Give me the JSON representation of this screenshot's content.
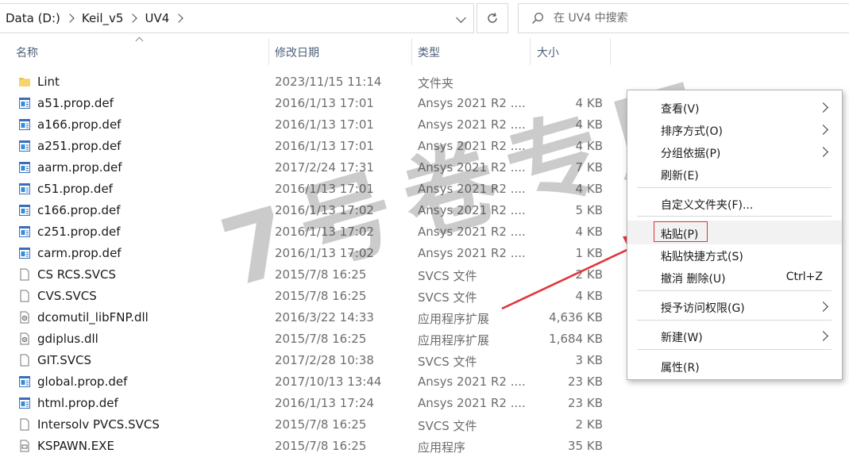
{
  "address_bar": {
    "crumbs": [
      "Data (D:)",
      "Keil_v5",
      "UV4"
    ]
  },
  "search": {
    "placeholder": "在 UV4 中搜索"
  },
  "columns": {
    "name": "名称",
    "date": "修改日期",
    "type": "类型",
    "size": "大小"
  },
  "files": [
    {
      "name": "Lint",
      "date": "2023/11/15 11:14",
      "type": "文件夹",
      "size": "",
      "icon": "folder-icon"
    },
    {
      "name": "a51.prop.def",
      "date": "2016/1/13 17:01",
      "type": "Ansys 2021 R2 ....",
      "size": "4 KB",
      "icon": "def-file-icon"
    },
    {
      "name": "a166.prop.def",
      "date": "2016/1/13 17:01",
      "type": "Ansys 2021 R2 ....",
      "size": "4 KB",
      "icon": "def-file-icon"
    },
    {
      "name": "a251.prop.def",
      "date": "2016/1/13 17:01",
      "type": "Ansys 2021 R2 ....",
      "size": "4 KB",
      "icon": "def-file-icon"
    },
    {
      "name": "aarm.prop.def",
      "date": "2017/2/24 17:31",
      "type": "Ansys 2021 R2 ....",
      "size": "7 KB",
      "icon": "def-file-icon"
    },
    {
      "name": "c51.prop.def",
      "date": "2016/1/13 17:01",
      "type": "Ansys 2021 R2 ....",
      "size": "4 KB",
      "icon": "def-file-icon"
    },
    {
      "name": "c166.prop.def",
      "date": "2016/1/13 17:02",
      "type": "Ansys 2021 R2 ....",
      "size": "5 KB",
      "icon": "def-file-icon"
    },
    {
      "name": "c251.prop.def",
      "date": "2016/1/13 17:02",
      "type": "Ansys 2021 R2 ....",
      "size": "4 KB",
      "icon": "def-file-icon"
    },
    {
      "name": "carm.prop.def",
      "date": "2016/1/13 17:02",
      "type": "Ansys 2021 R2 ....",
      "size": "1 KB",
      "icon": "def-file-icon"
    },
    {
      "name": "CS RCS.SVCS",
      "date": "2015/7/8 16:25",
      "type": "SVCS 文件",
      "size": "2 KB",
      "icon": "blank-file-icon"
    },
    {
      "name": "CVS.SVCS",
      "date": "2015/7/8 16:25",
      "type": "SVCS 文件",
      "size": "4 KB",
      "icon": "blank-file-icon"
    },
    {
      "name": "dcomutil_libFNP.dll",
      "date": "2016/3/22 14:33",
      "type": "应用程序扩展",
      "size": "4,636 KB",
      "icon": "dll-file-icon"
    },
    {
      "name": "gdiplus.dll",
      "date": "2015/7/8 16:25",
      "type": "应用程序扩展",
      "size": "1,684 KB",
      "icon": "dll-file-icon"
    },
    {
      "name": "GIT.SVCS",
      "date": "2017/2/28 10:38",
      "type": "SVCS 文件",
      "size": "3 KB",
      "icon": "blank-file-icon"
    },
    {
      "name": "global.prop.def",
      "date": "2017/10/13 13:44",
      "type": "Ansys 2021 R2 ....",
      "size": "23 KB",
      "icon": "def-file-icon"
    },
    {
      "name": "html.prop.def",
      "date": "2016/1/13 17:24",
      "type": "Ansys 2021 R2 ....",
      "size": "23 KB",
      "icon": "def-file-icon"
    },
    {
      "name": "Intersolv PVCS.SVCS",
      "date": "2015/7/8 16:25",
      "type": "SVCS 文件",
      "size": "2 KB",
      "icon": "blank-file-icon"
    },
    {
      "name": "KSPAWN.EXE",
      "date": "2015/7/8 16:25",
      "type": "应用程序",
      "size": "35 KB",
      "icon": "exe-file-icon"
    }
  ],
  "watermark": "7号卷专用",
  "context_menu": {
    "view": "查看(V)",
    "sort": "排序方式(O)",
    "group": "分组依据(P)",
    "refresh": "刷新(E)",
    "customize": "自定义文件夹(F)...",
    "paste": "粘贴(P)",
    "paste_shortcut": "粘贴快捷方式(S)",
    "undo_delete": "撤消 删除(U)",
    "undo_shortcut": "Ctrl+Z",
    "grant_access": "授予访问权限(G)",
    "new": "新建(W)",
    "properties": "属性(R)"
  },
  "colors": {
    "annotation_red": "#e0363c",
    "header_text": "#4c607a",
    "folder_yellow": "#f2c14e"
  }
}
